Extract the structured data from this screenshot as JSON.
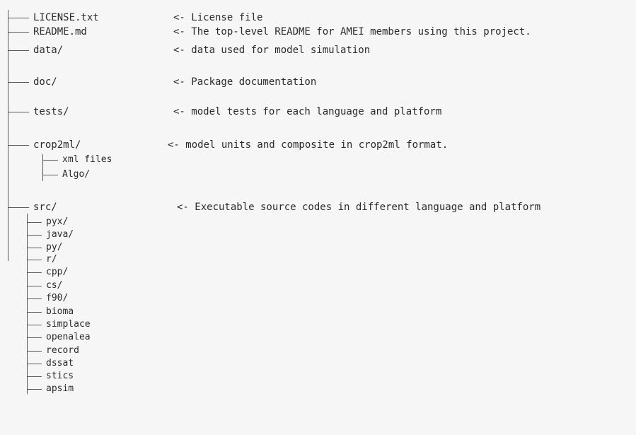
{
  "tree": {
    "entries": [
      {
        "name": "LICENSE.txt",
        "desc": "<- License file"
      },
      {
        "name": "README.md",
        "desc": "<- The top-level README for AMEI members using this project."
      },
      {
        "name": "data/",
        "desc": "<- data used for model simulation"
      },
      {
        "name": "doc/",
        "desc": "<- Package documentation"
      },
      {
        "name": "tests/",
        "desc": "<- model tests for each language and platform"
      },
      {
        "name": "crop2ml/",
        "desc": "<- model units and composite in crop2ml format."
      },
      {
        "name": "xml files"
      },
      {
        "name": "Algo/"
      },
      {
        "name": "src/",
        "desc": "<- Executable source codes in different language and platform"
      },
      {
        "name": "pyx/"
      },
      {
        "name": "java/"
      },
      {
        "name": "py/"
      },
      {
        "name": "r/"
      },
      {
        "name": "cpp/"
      },
      {
        "name": "cs/"
      },
      {
        "name": "f90/"
      },
      {
        "name": "bioma"
      },
      {
        "name": "simplace"
      },
      {
        "name": "openalea"
      },
      {
        "name": "record"
      },
      {
        "name": "dssat"
      },
      {
        "name": "stics"
      },
      {
        "name": "apsim"
      }
    ]
  }
}
